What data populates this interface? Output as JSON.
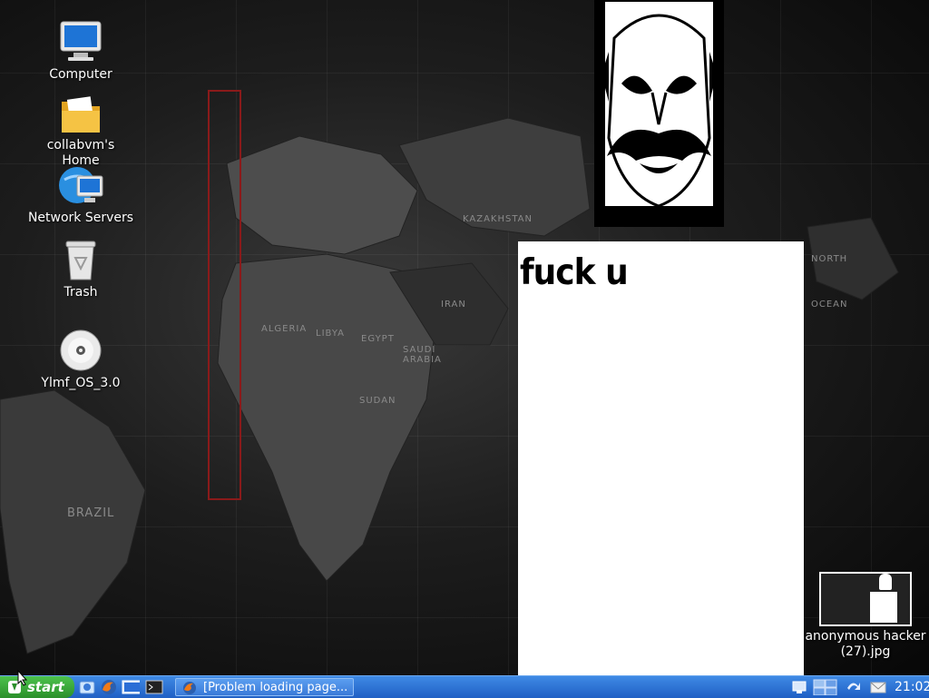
{
  "desktop": {
    "icons": [
      {
        "label": "Computer",
        "icon": "computer-icon"
      },
      {
        "label": "collabvm's Home",
        "icon": "home-folder-icon"
      },
      {
        "label": "Network Servers",
        "icon": "network-servers-icon"
      },
      {
        "label": "Trash",
        "icon": "trash-icon"
      },
      {
        "label": "Ylmf_OS_3.0",
        "icon": "cd-disc-icon"
      }
    ],
    "wallpaper_labels": [
      "ALGERIA",
      "LIBYA",
      "EGYPT",
      "SUDAN",
      "SAUDI ARABIA",
      "IRAN",
      "BRAZIL",
      "NORTH",
      "OCEAN",
      "KAZAKHSTAN"
    ],
    "file_icon": {
      "label": "anonymous hacker (27).jpg"
    }
  },
  "note": {
    "text": "fuck u"
  },
  "taskbar": {
    "start_label": "start",
    "quick_launch": [
      "home-icon",
      "firefox-icon",
      "desktop-icon",
      "terminal-icon"
    ],
    "task": {
      "label": "[Problem loading page..."
    },
    "tray": [
      "network-icon",
      "workspace-switcher-icon",
      "updates-icon",
      "mail-icon"
    ],
    "clock": "21:02"
  },
  "colors": {
    "taskbar": "#2a6ed6",
    "start": "#3aa83a",
    "desktop_bg": "#1a1a1a"
  }
}
